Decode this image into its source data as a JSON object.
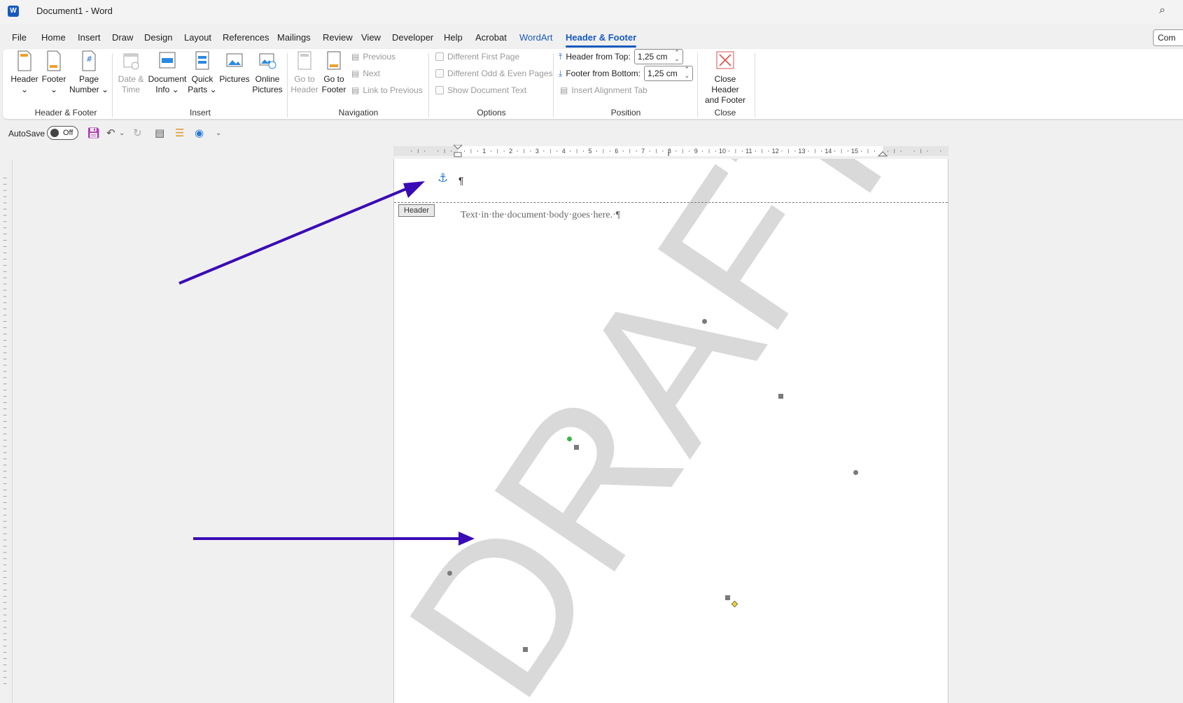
{
  "window": {
    "app_logo": "W",
    "title": "Document1  -  Word"
  },
  "menu": {
    "tabs": [
      "File",
      "Home",
      "Insert",
      "Draw",
      "Design",
      "Layout",
      "References",
      "Mailings",
      "Review",
      "View",
      "Developer",
      "Help",
      "Acrobat",
      "WordArt",
      "Header & Footer"
    ],
    "comments_label": "Com"
  },
  "ribbon": {
    "header_footer": {
      "header": "Header",
      "footer": "Footer",
      "page_number_1": "Page",
      "page_number_2": "Number",
      "label": "Header & Footer"
    },
    "insert": {
      "date_1": "Date &",
      "date_2": "Time",
      "docinfo_1": "Document",
      "docinfo_2": "Info",
      "quick_1": "Quick",
      "quick_2": "Parts",
      "pictures": "Pictures",
      "online_1": "Online",
      "online_2": "Pictures",
      "label": "Insert"
    },
    "navigation": {
      "goto_header_1": "Go to",
      "goto_header_2": "Header",
      "goto_footer_1": "Go to",
      "goto_footer_2": "Footer",
      "previous": "Previous",
      "next": "Next",
      "link_previous": "Link to Previous",
      "label": "Navigation"
    },
    "options": {
      "different_first": "Different First Page",
      "different_odd_even": "Different Odd & Even Pages",
      "show_doc_text": "Show Document Text",
      "label": "Options"
    },
    "position": {
      "header_from_top": "Header from Top:",
      "header_value": "1,25 cm",
      "footer_from_bottom": "Footer from Bottom:",
      "footer_value": "1,25 cm",
      "insert_alignment_tab": "Insert Alignment Tab",
      "label": "Position"
    },
    "close": {
      "close_1": "Close Header",
      "close_2": "and Footer",
      "label": "Close"
    }
  },
  "qat": {
    "autosave": "AutoSave",
    "toggle": "Off"
  },
  "ruler": {
    "ticks": [
      "1",
      "2",
      "3",
      "4",
      "5",
      "6",
      "7",
      "8",
      "9",
      "10",
      "11",
      "12",
      "13",
      "14",
      "15"
    ]
  },
  "document": {
    "header_tag": "Header",
    "body_text": "Text·in·the·document·body·goes·here.·¶",
    "header_mark": "¶",
    "watermark": "DRAFT"
  },
  "colors": {
    "accent": "#185abd",
    "arrow": "#3a0bb5",
    "watermark": "#d9d9d9"
  }
}
